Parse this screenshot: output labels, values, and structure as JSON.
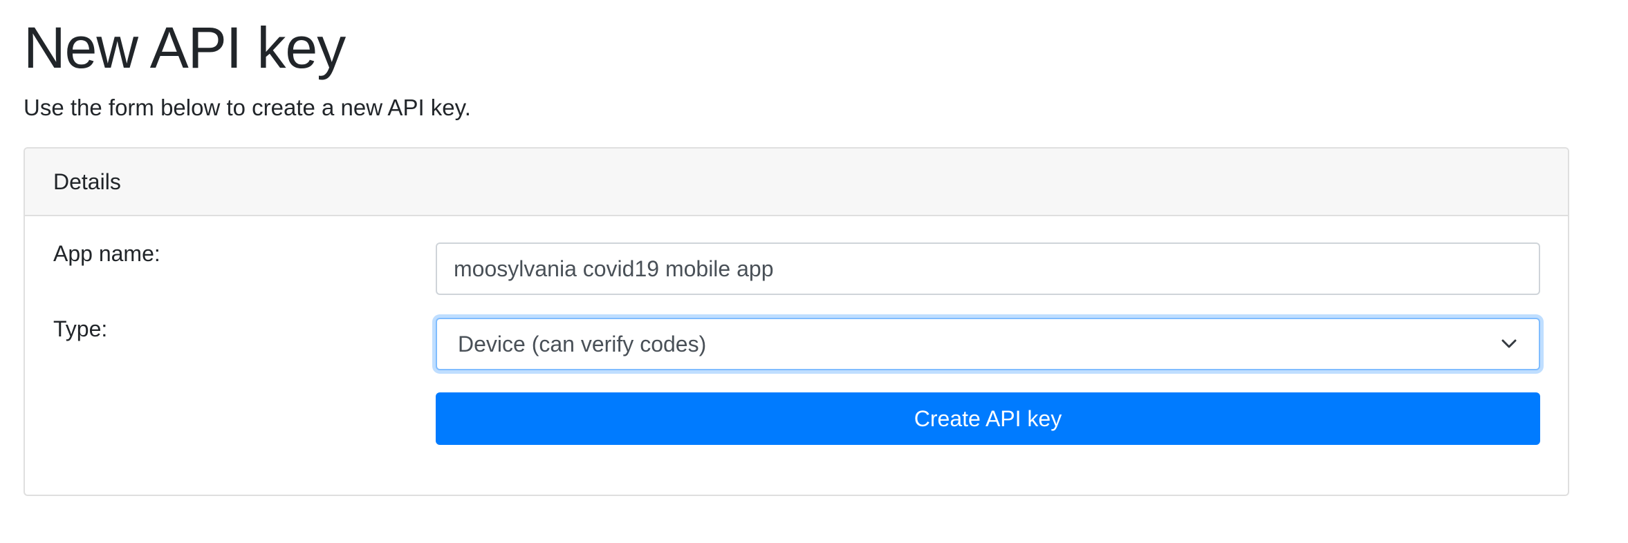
{
  "page": {
    "title": "New API key",
    "description": "Use the form below to create a new API key."
  },
  "card": {
    "header": "Details"
  },
  "form": {
    "app_name": {
      "label": "App name:",
      "value": "moosylvania covid19 mobile app"
    },
    "type": {
      "label": "Type:",
      "selected": "Device (can verify codes)",
      "icon": "chevron-down-icon"
    },
    "submit_label": "Create API key"
  },
  "colors": {
    "primary": "#007bff",
    "focus_border": "#80bdff",
    "card_header_bg": "#f7f7f7",
    "text": "#212529"
  }
}
